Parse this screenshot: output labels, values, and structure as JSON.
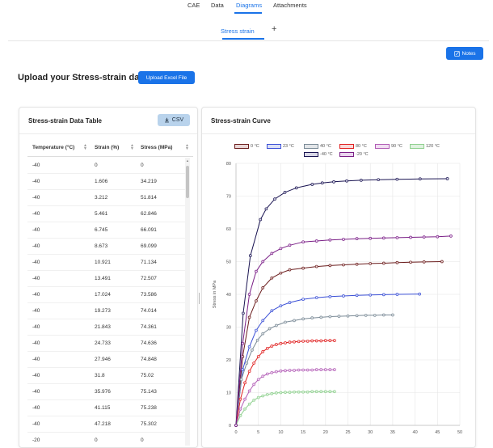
{
  "nav": {
    "tabs": [
      {
        "label": "CAE"
      },
      {
        "label": "Data"
      },
      {
        "label": "Diagrams"
      },
      {
        "label": "Attachments"
      }
    ],
    "active_tab": "Diagrams"
  },
  "subnav": {
    "active_subtab": "Stress strain",
    "add_label": "+"
  },
  "notes_button": {
    "label": "Notes"
  },
  "upload": {
    "label": "Upload your Stress-strain data:",
    "button_label": "Upload Excel File"
  },
  "table_panel": {
    "title": "Stress-strain Data Table",
    "csv_label": "CSV",
    "columns": [
      "Temperature (°C)",
      "Strain (%)",
      "Stress (MPa)"
    ],
    "rows": [
      [
        "-40",
        "0",
        "0"
      ],
      [
        "-40",
        "1.606",
        "34.219"
      ],
      [
        "-40",
        "3.212",
        "51.814"
      ],
      [
        "-40",
        "5.461",
        "62.846"
      ],
      [
        "-40",
        "6.745",
        "66.091"
      ],
      [
        "-40",
        "8.673",
        "69.099"
      ],
      [
        "-40",
        "10.921",
        "71.134"
      ],
      [
        "-40",
        "13.491",
        "72.507"
      ],
      [
        "-40",
        "17.024",
        "73.586"
      ],
      [
        "-40",
        "19.273",
        "74.014"
      ],
      [
        "-40",
        "21.843",
        "74.361"
      ],
      [
        "-40",
        "24.733",
        "74.636"
      ],
      [
        "-40",
        "27.946",
        "74.848"
      ],
      [
        "-40",
        "31.8",
        "75.02"
      ],
      [
        "-40",
        "35.976",
        "75.143"
      ],
      [
        "-40",
        "41.115",
        "75.238"
      ],
      [
        "-40",
        "47.218",
        "75.302"
      ],
      [
        "-20",
        "0",
        "0"
      ]
    ]
  },
  "chart_panel": {
    "title": "Stress-strain Curve"
  },
  "chart_data": {
    "type": "line",
    "title": "",
    "xlabel": "",
    "ylabel": "Stress in MPa",
    "xlim": [
      0,
      50
    ],
    "ylim": [
      0,
      80
    ],
    "xticks": [
      "0",
      "5",
      "10",
      "15",
      "20",
      "25",
      "30",
      "35",
      "40",
      "45",
      "50"
    ],
    "yticks": [
      "0",
      "10",
      "20",
      "30",
      "40",
      "50",
      "60",
      "70",
      "80"
    ],
    "grid": true,
    "legend_placement": "top",
    "series": [
      {
        "name": "0 °C",
        "color": "#6b1d1d",
        "fill": "#e9d6d6",
        "x": [
          0,
          1.5,
          3,
          4.5,
          6,
          8,
          10,
          12,
          15,
          18,
          21,
          24,
          27,
          30,
          33,
          36,
          39,
          42,
          46
        ],
        "y": [
          0,
          21,
          33,
          38,
          42,
          45,
          46.5,
          47.5,
          48,
          48.5,
          48.8,
          49,
          49.2,
          49.4,
          49.5,
          49.7,
          49.8,
          49.9,
          50
        ]
      },
      {
        "name": "23 °C",
        "color": "#3a4fd6",
        "fill": "#dbe0f7",
        "x": [
          0,
          1.5,
          3,
          4.5,
          6,
          8,
          10,
          12,
          15,
          18,
          21,
          24,
          27,
          30,
          33,
          36,
          41
        ],
        "y": [
          0,
          17,
          24,
          29,
          32,
          35,
          36.5,
          37.5,
          38.5,
          39,
          39.3,
          39.5,
          39.7,
          39.8,
          39.9,
          40,
          40.1
        ]
      },
      {
        "name": "40 °C",
        "color": "#7a8a96",
        "fill": "#e3e6e9",
        "x": [
          0,
          1.2,
          2.4,
          3.6,
          4.8,
          6,
          7.5,
          9,
          11,
          13,
          15,
          17,
          19,
          21,
          23,
          25,
          27,
          29,
          31,
          33,
          35
        ],
        "y": [
          0,
          14,
          19,
          23,
          26,
          28,
          29.5,
          30.5,
          31.5,
          32,
          32.5,
          32.8,
          33,
          33.2,
          33.3,
          33.4,
          33.5,
          33.6,
          33.6,
          33.7,
          33.7
        ]
      },
      {
        "name": "80 °C",
        "color": "#e01f1f",
        "fill": "#f9d8d8",
        "x": [
          0,
          1,
          2,
          3,
          4,
          5,
          6,
          7,
          8,
          9,
          10,
          11,
          12,
          13,
          14,
          15,
          16,
          17,
          18,
          19,
          20,
          21,
          22
        ],
        "y": [
          0,
          8,
          13,
          16.5,
          19,
          21,
          22.5,
          23.5,
          24.2,
          24.7,
          25,
          25.2,
          25.4,
          25.5,
          25.6,
          25.7,
          25.7,
          25.8,
          25.8,
          25.8,
          25.9,
          25.9,
          25.9
        ]
      },
      {
        "name": "90 °C",
        "color": "#b15cb5",
        "fill": "#f1def2",
        "x": [
          0,
          1,
          2,
          3,
          4,
          5,
          6,
          7,
          8,
          9,
          10,
          11,
          12,
          13,
          14,
          15,
          16,
          17,
          18,
          19,
          20,
          21,
          22
        ],
        "y": [
          0,
          5,
          8,
          10.5,
          12.5,
          14,
          15,
          15.7,
          16.1,
          16.4,
          16.6,
          16.7,
          16.8,
          16.8,
          16.9,
          16.9,
          16.9,
          16.9,
          17,
          17,
          17,
          17,
          17
        ]
      },
      {
        "name": "120 °C",
        "color": "#8fd08f",
        "fill": "#dff2df",
        "x": [
          0,
          1,
          2,
          3,
          4,
          5,
          6,
          7,
          8,
          9,
          10,
          11,
          12,
          13,
          14,
          15,
          16,
          17,
          18,
          19,
          20,
          21,
          22
        ],
        "y": [
          0,
          3,
          5,
          6.5,
          7.7,
          8.5,
          9,
          9.4,
          9.7,
          9.9,
          10,
          10.1,
          10.1,
          10.2,
          10.2,
          10.2,
          10.2,
          10.3,
          10.3,
          10.3,
          10.3,
          10.3,
          10.3
        ]
      },
      {
        "name": "-40 °C",
        "color": "#1a1452",
        "fill": "#d8d7e6",
        "x": [
          0,
          1.606,
          3.212,
          5.461,
          6.745,
          8.673,
          10.921,
          13.491,
          17.024,
          19.273,
          21.843,
          24.733,
          27.946,
          31.8,
          35.976,
          41.115,
          47.218
        ],
        "y": [
          0,
          34.219,
          51.814,
          62.846,
          66.091,
          69.099,
          71.134,
          72.507,
          73.586,
          74.014,
          74.361,
          74.636,
          74.848,
          75.02,
          75.143,
          75.238,
          75.302
        ]
      },
      {
        "name": "-20 °C",
        "color": "#7a1f86",
        "fill": "#ead5ee",
        "x": [
          0,
          1.5,
          3,
          4.5,
          6,
          8,
          10,
          12,
          15,
          18,
          21,
          24,
          27,
          30,
          33,
          36,
          39,
          42,
          45,
          48
        ],
        "y": [
          0,
          25,
          40,
          47,
          50,
          52.5,
          54,
          55,
          56,
          56.3,
          56.6,
          56.8,
          57,
          57.1,
          57.2,
          57.3,
          57.4,
          57.5,
          57.6,
          57.8
        ]
      }
    ]
  }
}
